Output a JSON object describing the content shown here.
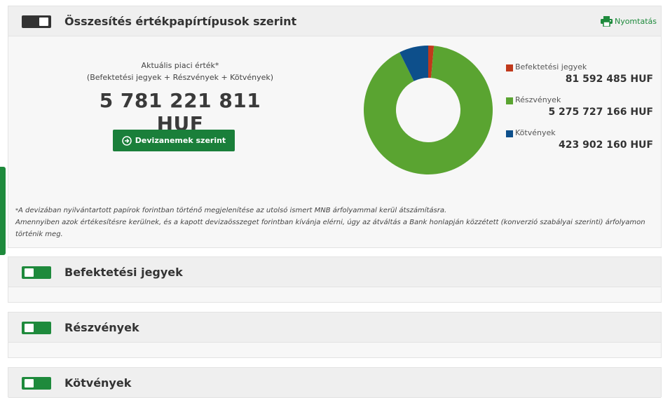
{
  "summary": {
    "title": "Összesítés értékpapírtípusok szerint",
    "print_label": "Nyomtatás",
    "value_label": "Aktuális piaci érték*",
    "value_sublabel": "(Befektetési jegyek + Részvények + Kötvények)",
    "total_value": "5 781 221 811 HUF",
    "currency_button_label": "Devizanemek szerint",
    "footnote_marker": "*",
    "footnote_line1": "A devizában nyilvántartott papírok forintban történő megjelenítése az utolsó ismert MNB árfolyammal kerül átszámításra.",
    "footnote_line2": "Amennyiben azok értékesítésre kerülnek, és a kapott devizaösszeget forintban kívánja elérni, úgy az átváltás a Bank honlapján közzétett (konverzió szabályai szerinti) árfolyamon történik meg.",
    "legend": [
      {
        "label": "Befektetési jegyek",
        "value": "81 592 485 HUF",
        "color": "#c0391b"
      },
      {
        "label": "Részvények",
        "value": "5 275 727 166 HUF",
        "color": "#5aa431"
      },
      {
        "label": "Kötvények",
        "value": "423 902 160 HUF",
        "color": "#0d4f8b"
      }
    ]
  },
  "chart_data": {
    "type": "pie",
    "variant": "donut",
    "categories": [
      "Befektetési jegyek",
      "Részvények",
      "Kötvények"
    ],
    "values": [
      81592485,
      5275727166,
      423902160
    ],
    "colors": [
      "#c0391b",
      "#5aa431",
      "#0d4f8b"
    ]
  },
  "sections": [
    {
      "title": "Befektetési jegyek"
    },
    {
      "title": "Részvények"
    },
    {
      "title": "Kötvények"
    }
  ],
  "colors": {
    "accent_green": "#1e8a3c",
    "toggle_dark": "#333333"
  }
}
